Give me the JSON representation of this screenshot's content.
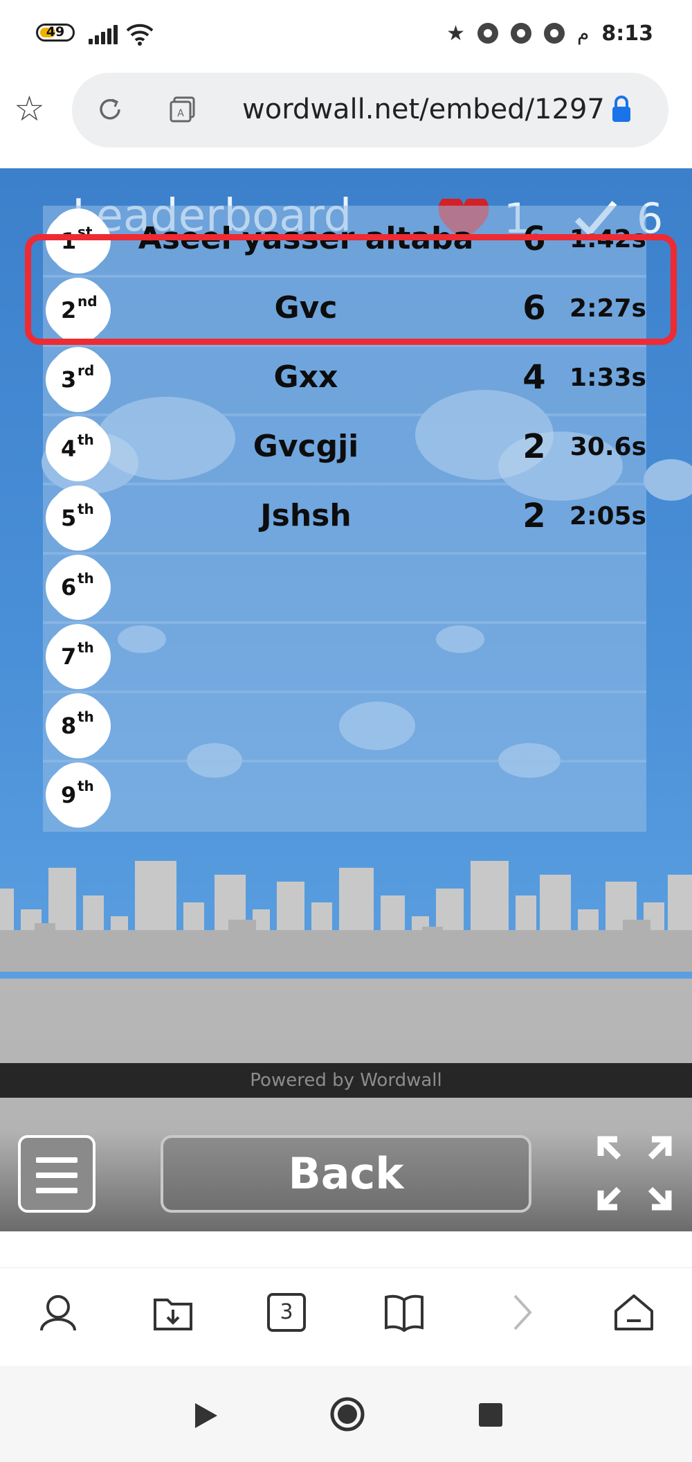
{
  "status_bar": {
    "battery": "49",
    "battery_level": 0.49,
    "time": "8:13",
    "ampm": "م"
  },
  "browser": {
    "url": "wordwall.net/embed/1297",
    "tab_count": "3"
  },
  "game": {
    "title": "Leaderboard",
    "lives": "1",
    "correct": "6",
    "rows": [
      {
        "rank": "1",
        "suffix": "st",
        "name": "Aseel yasser altaba",
        "score": "6",
        "time": "1:42s"
      },
      {
        "rank": "2",
        "suffix": "nd",
        "name": "Gvc",
        "score": "6",
        "time": "2:27s"
      },
      {
        "rank": "3",
        "suffix": "rd",
        "name": "Gxx",
        "score": "4",
        "time": "1:33s"
      },
      {
        "rank": "4",
        "suffix": "th",
        "name": "Gvcgji",
        "score": "2",
        "time": "30.6s"
      },
      {
        "rank": "5",
        "suffix": "th",
        "name": "Jshsh",
        "score": "2",
        "time": "2:05s"
      },
      {
        "rank": "6",
        "suffix": "th",
        "name": "",
        "score": "",
        "time": ""
      },
      {
        "rank": "7",
        "suffix": "th",
        "name": "",
        "score": "",
        "time": ""
      },
      {
        "rank": "8",
        "suffix": "th",
        "name": "",
        "score": "",
        "time": ""
      },
      {
        "rank": "9",
        "suffix": "th",
        "name": "",
        "score": "",
        "time": ""
      }
    ],
    "back_label": "Back",
    "powered_by": "Powered by Wordwall"
  },
  "colors": {
    "sky": "#3f84cf",
    "highlight": "#ee2a33",
    "ground": "#b5b5b5"
  },
  "icons": {
    "status": [
      "star-icon",
      "chrome-icon",
      "chrome-icon",
      "chrome-icon"
    ],
    "toolbar": [
      "profile-icon",
      "download-folder-icon",
      "tabs-icon",
      "reading-icon",
      "forward-icon",
      "home-icon"
    ],
    "nav": [
      "back-triangle-icon",
      "home-circle-icon",
      "recents-square-icon"
    ]
  }
}
